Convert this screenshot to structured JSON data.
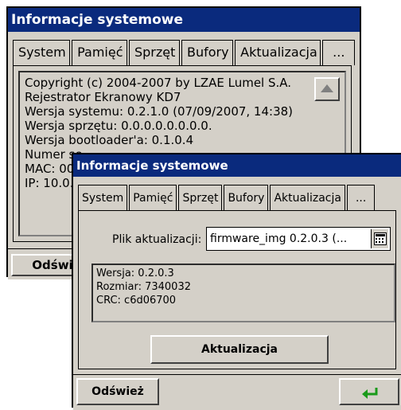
{
  "window_back": {
    "title": "Informacje systemowe",
    "tabs": [
      {
        "label": "System"
      },
      {
        "label": "Pamięć"
      },
      {
        "label": "Sprzęt"
      },
      {
        "label": "Bufory"
      },
      {
        "label": "Aktualizacja"
      },
      {
        "label": "..."
      }
    ],
    "active_tab": "System",
    "info_lines": [
      "Copyright (c) 2004-2007 by LZAE Lumel S.A.",
      "Rejestrator Ekranowy KD7",
      "Wersja systemu: 0.2.1.0 (07/09/2007, 14:38)",
      "Wersja sprzętu: 0.0.0.0.0.0.0.0.",
      "Wersja bootloader'a: 0.1.0.4",
      "Numer se",
      "MAC: 00",
      "IP: 10.0."
    ],
    "refresh_label": "Odświ"
  },
  "window_front": {
    "title": "Informacje systemowe",
    "tabs": [
      {
        "label": "System"
      },
      {
        "label": "Pamięć"
      },
      {
        "label": "Sprzęt"
      },
      {
        "label": "Bufory"
      },
      {
        "label": "Aktualizacja"
      },
      {
        "label": "..."
      }
    ],
    "active_tab": "Aktualizacja",
    "file_label": "Plik aktualizacji:",
    "file_value": "firmware_img 0.2.0.3 (...",
    "info_lines": [
      "Wersja: 0.2.0.3",
      "Rozmiar: 7340032",
      "CRC: c6d06700"
    ],
    "update_button": "Aktualizacja",
    "refresh_label": "Odśwież",
    "enter_icon": "enter-arrow-icon",
    "enter_icon_color": "#1a9a1a"
  }
}
